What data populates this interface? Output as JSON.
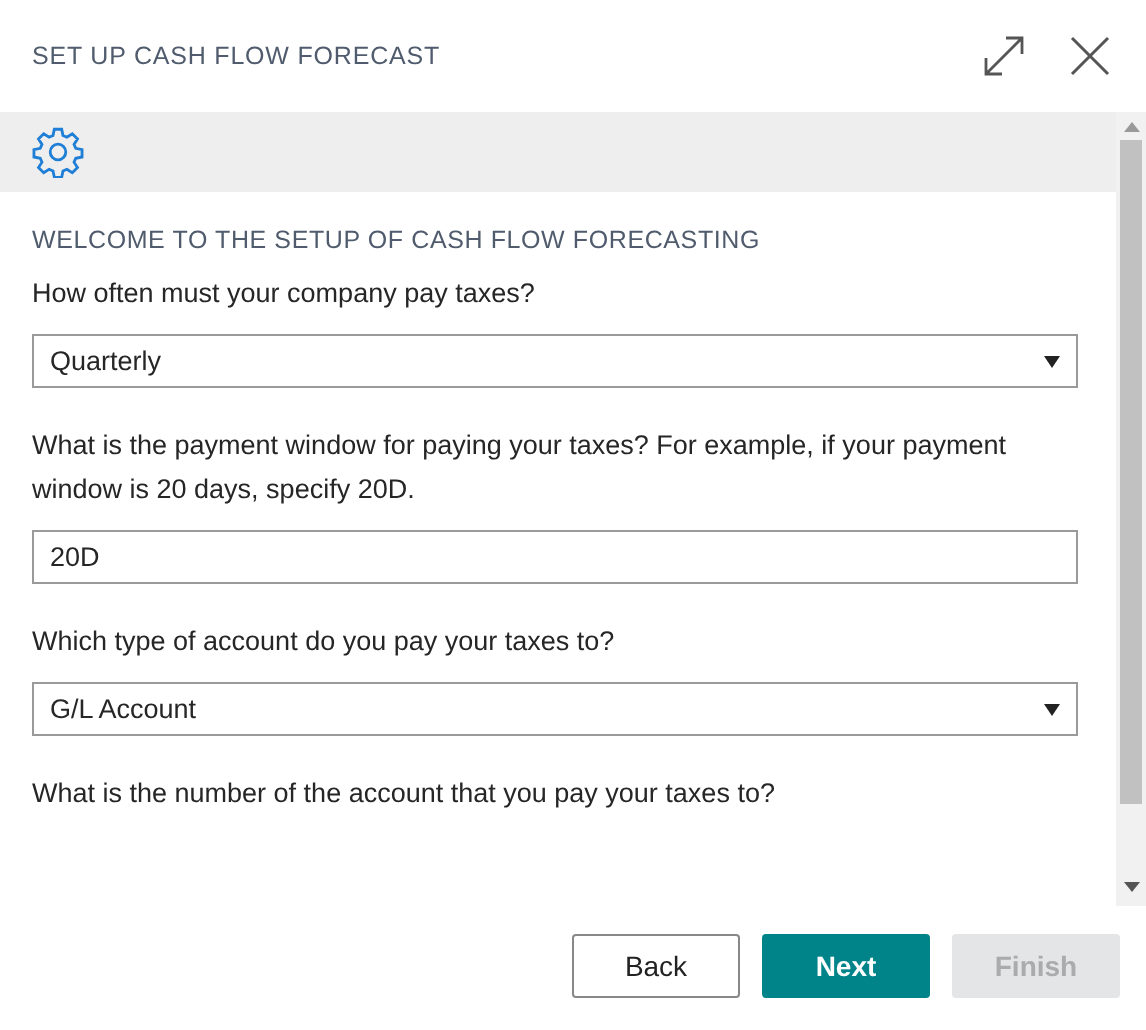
{
  "window": {
    "title": "SET UP CASH FLOW FORECAST"
  },
  "heading": "WELCOME TO THE SETUP OF CASH FLOW FORECASTING",
  "fields": [
    {
      "question": "How often must your company pay taxes?",
      "kind": "select",
      "value": "Quarterly"
    },
    {
      "question": "What is the payment window for paying your taxes? For example, if your payment window is 20 days, specify 20D.",
      "kind": "text",
      "value": "20D"
    },
    {
      "question": "Which type of account do you pay your taxes to?",
      "kind": "select",
      "value": "G/L Account"
    },
    {
      "question": "What is the number of the account that you pay your taxes to?",
      "kind": "none"
    }
  ],
  "buttons": [
    {
      "label": "Back",
      "primary": false,
      "disabled": false
    },
    {
      "label": "Next",
      "primary": true,
      "disabled": false
    },
    {
      "label": "Finish",
      "primary": false,
      "disabled": true
    }
  ]
}
